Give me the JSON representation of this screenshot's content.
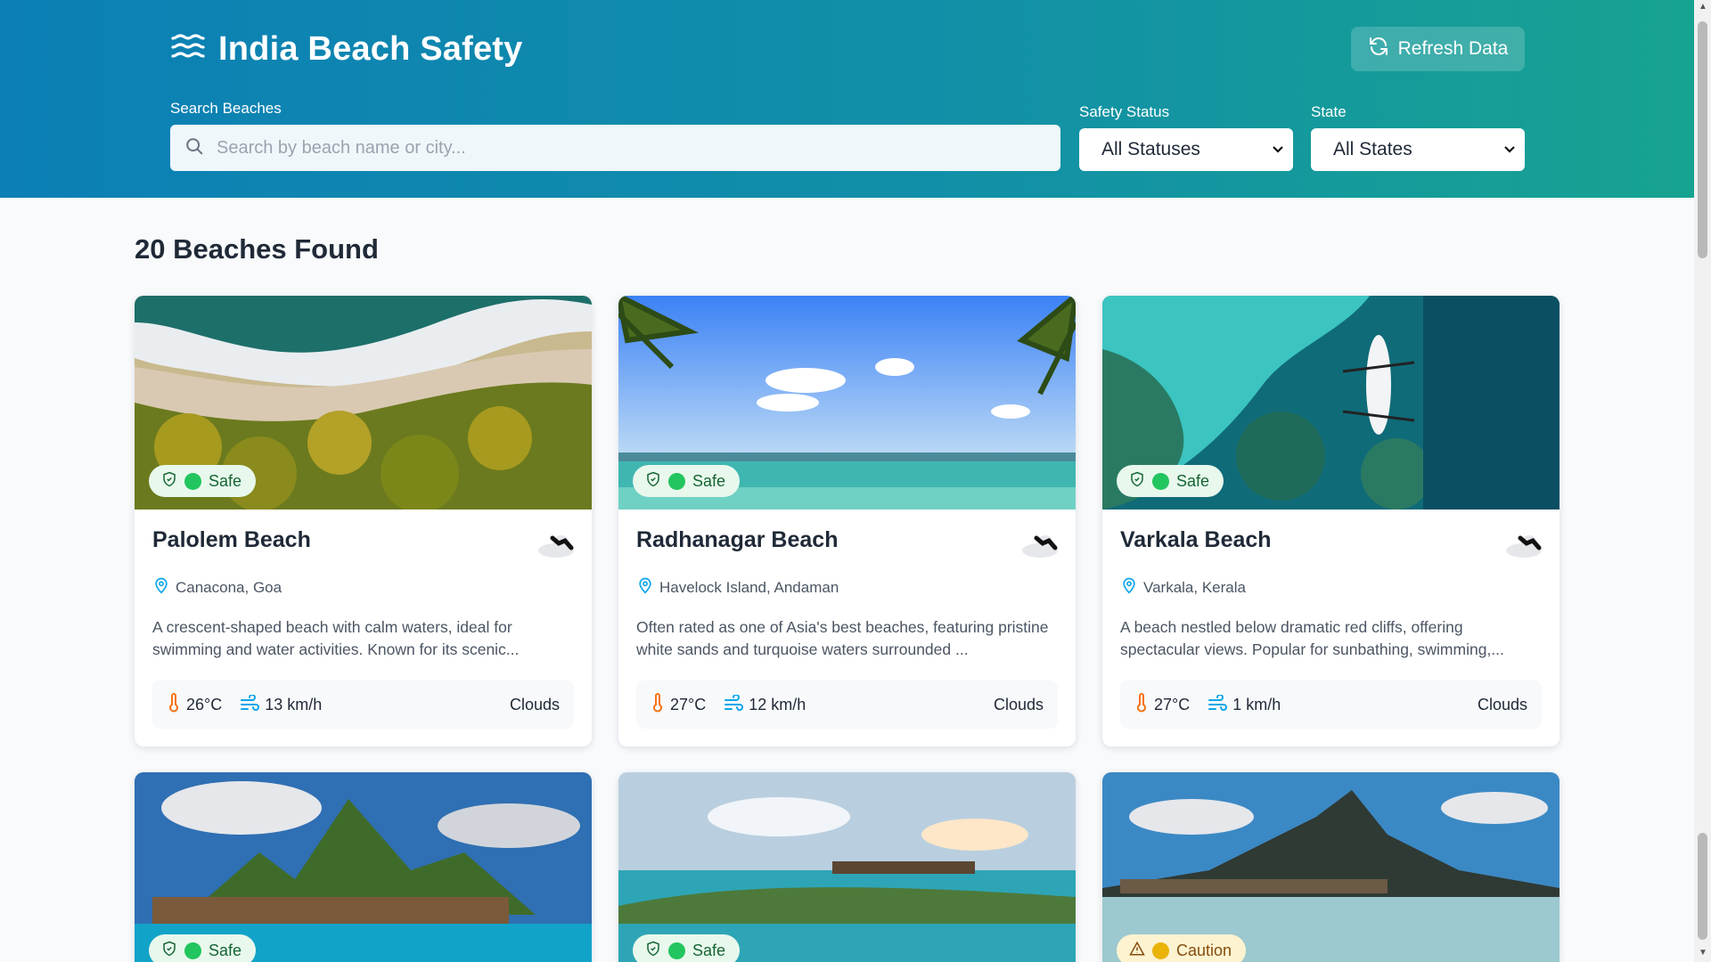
{
  "header": {
    "title": "India Beach Safety",
    "refresh_label": "Refresh Data",
    "search_label": "Search Beaches",
    "search_placeholder": "Search by beach name or city...",
    "status_label": "Safety Status",
    "status_value": "All Statuses",
    "state_label": "State",
    "state_value": "All States"
  },
  "results_title": "20 Beaches Found",
  "colors": {
    "safe": "#22c55e",
    "caution": "#eab308",
    "accent": "#0b7fb6"
  },
  "cards": [
    {
      "name": "Palolem Beach",
      "location": "Canacona, Goa",
      "description": "A crescent-shaped beach with calm waters, ideal for swimming and water activities. Known for its scenic...",
      "temp": "26°C",
      "wind": "13 km/h",
      "condition": "Clouds",
      "status": "Safe",
      "weather_icon": "clouds-icon"
    },
    {
      "name": "Radhanagar Beach",
      "location": "Havelock Island, Andaman",
      "description": "Often rated as one of Asia's best beaches, featuring pristine white sands and turquoise waters surrounded ...",
      "temp": "27°C",
      "wind": "12 km/h",
      "condition": "Clouds",
      "status": "Safe",
      "weather_icon": "clouds-icon"
    },
    {
      "name": "Varkala Beach",
      "location": "Varkala, Kerala",
      "description": "A beach nestled below dramatic red cliffs, offering spectacular views. Popular for sunbathing, swimming,...",
      "temp": "27°C",
      "wind": "1 km/h",
      "condition": "Clouds",
      "status": "Safe",
      "weather_icon": "clouds-icon"
    },
    {
      "status": "Safe"
    },
    {
      "status": "Safe"
    },
    {
      "status": "Caution"
    }
  ]
}
